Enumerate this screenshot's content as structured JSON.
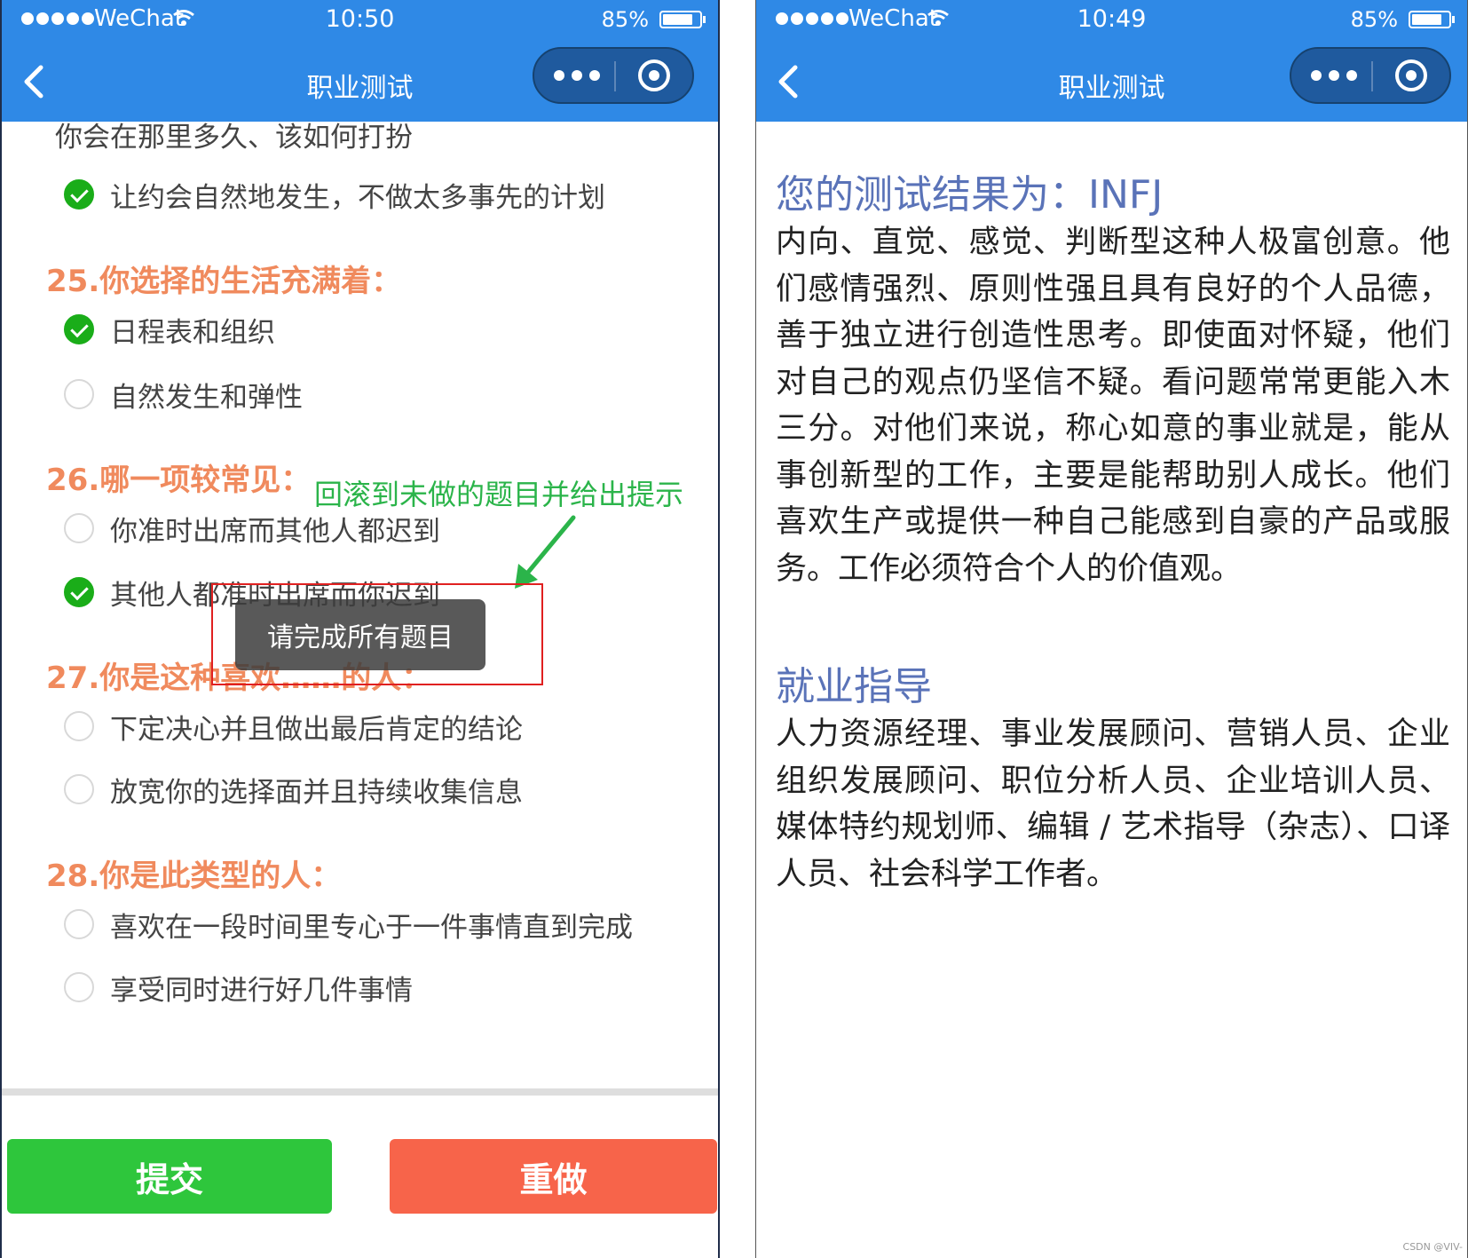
{
  "left_screen": {
    "status": {
      "carrier": "WeChat",
      "time": "10:50",
      "battery": "85%",
      "battery_level": 0.85
    },
    "nav": {
      "title": "职业测试"
    },
    "question_fragment": "你会在那里多久、该如何打扮",
    "q24_selected_option": "让约会自然地发生，不做太多事先的计划",
    "questions": [
      {
        "title": "25.你选择的生活充满着：",
        "options": [
          {
            "label": "日程表和组织",
            "checked": true
          },
          {
            "label": "自然发生和弹性",
            "checked": false
          }
        ]
      },
      {
        "title": "26.哪一项较常见：",
        "options": [
          {
            "label": "你准时出席而其他人都迟到",
            "checked": false
          },
          {
            "label": "其他人都准时出席而你迟到",
            "checked": true
          }
        ]
      },
      {
        "title": "27.你是这种喜欢……的人：",
        "options": [
          {
            "label": "下定决心并且做出最后肯定的结论",
            "checked": false
          },
          {
            "label": "放宽你的选择面并且持续收集信息",
            "checked": false
          }
        ]
      },
      {
        "title": "28.你是此类型的人：",
        "options": [
          {
            "label": "喜欢在一段时间里专心于一件事情直到完成",
            "checked": false
          },
          {
            "label": "享受同时进行好几件事情",
            "checked": false
          }
        ]
      }
    ],
    "annotation": "回滚到未做的题目并给出提示",
    "toast": "请完成所有题目",
    "buttons": {
      "submit": "提交",
      "redo": "重做"
    }
  },
  "right_screen": {
    "status": {
      "carrier": "WeChat",
      "time": "10:49",
      "battery": "85%",
      "battery_level": 0.85
    },
    "nav": {
      "title": "职业测试"
    },
    "result_heading": "您的测试结果为：INFJ",
    "result_text": "内向、直觉、感觉、判断型这种人极富创意。他们感情强烈、原则性强且具有良好的个人品德，善于独立进行创造性思考。即使面对怀疑，他们对自己的观点仍坚信不疑。看问题常常更能入木三分。对他们来说，称心如意的事业就是，能从事创新型的工作，主要是能帮助别人成长。他们喜欢生产或提供一种自己能感到自豪的产品或服务。工作必须符合个人的价值观。",
    "career_heading": "就业指导",
    "career_text": "人力资源经理、事业发展顾问、营销人员、企业组织发展顾问、职位分析人员、企业培训人员、媒体特约规划师、编辑 / 艺术指导（杂志）、口译人员、社会科学工作者。"
  },
  "watermark": "CSDN @VIV-",
  "colors": {
    "nav_bg": "#2f89e6",
    "question_title": "#f08a5d",
    "check_green": "#1aad19",
    "annotation_green": "#2bb44a",
    "submit_bg": "#2ec63c",
    "redo_bg": "#f7644a",
    "result_heading": "#5a73b8"
  }
}
